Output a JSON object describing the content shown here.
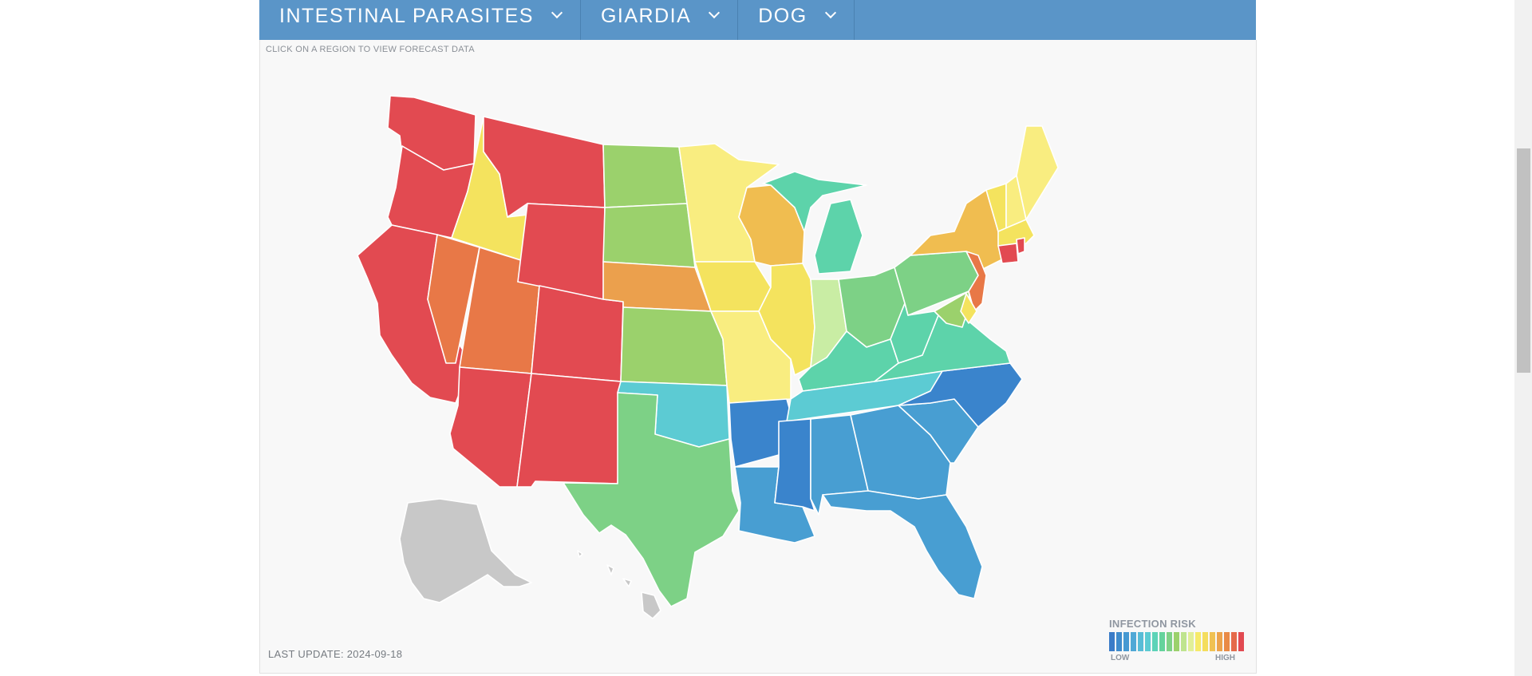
{
  "nav": {
    "items": [
      {
        "label": "INTESTINAL PARASITES"
      },
      {
        "label": "GIARDIA"
      },
      {
        "label": "DOG"
      }
    ]
  },
  "map": {
    "hint": "CLICK ON A REGION TO VIEW FORECAST DATA",
    "last_update": "LAST UPDATE: 2024-09-18",
    "colors": {
      "red": "#e24a51",
      "orange_red": "#e87847",
      "orange": "#eba04d",
      "orange_yellow": "#f0bd50",
      "yellow": "#f4e35e",
      "light_yellow": "#f9ed80",
      "pale_green": "#c9eda4",
      "green": "#9bd16c",
      "green2": "#7dd186",
      "teal": "#5dd3aa",
      "cyan": "#5ccbd3",
      "blue_light": "#489ed2",
      "blue": "#3a84cc",
      "gray": "#c8c8c8"
    },
    "regions": [
      {
        "name": "Washington",
        "level": "red"
      },
      {
        "name": "Oregon",
        "level": "red"
      },
      {
        "name": "California",
        "level": "red"
      },
      {
        "name": "Idaho",
        "level": "yellow"
      },
      {
        "name": "Nevada",
        "level": "orange_red"
      },
      {
        "name": "Utah",
        "level": "orange_red"
      },
      {
        "name": "Arizona",
        "level": "red"
      },
      {
        "name": "Montana",
        "level": "red"
      },
      {
        "name": "Wyoming",
        "level": "red"
      },
      {
        "name": "Colorado",
        "level": "red"
      },
      {
        "name": "New Mexico",
        "level": "red"
      },
      {
        "name": "North Dakota",
        "level": "green"
      },
      {
        "name": "South Dakota",
        "level": "green"
      },
      {
        "name": "Nebraska",
        "level": "orange"
      },
      {
        "name": "Kansas",
        "level": "green"
      },
      {
        "name": "Oklahoma",
        "level": "cyan"
      },
      {
        "name": "Texas",
        "level": "green2"
      },
      {
        "name": "Minnesota",
        "level": "light_yellow"
      },
      {
        "name": "Iowa",
        "level": "yellow"
      },
      {
        "name": "Missouri",
        "level": "light_yellow"
      },
      {
        "name": "Arkansas",
        "level": "blue"
      },
      {
        "name": "Louisiana",
        "level": "blue_light"
      },
      {
        "name": "Wisconsin",
        "level": "orange_yellow"
      },
      {
        "name": "Illinois",
        "level": "yellow"
      },
      {
        "name": "Michigan",
        "level": "teal"
      },
      {
        "name": "Indiana",
        "level": "pale_green"
      },
      {
        "name": "Ohio",
        "level": "green2"
      },
      {
        "name": "Kentucky",
        "level": "teal"
      },
      {
        "name": "Tennessee",
        "level": "cyan"
      },
      {
        "name": "Mississippi",
        "level": "blue"
      },
      {
        "name": "Alabama",
        "level": "blue_light"
      },
      {
        "name": "Georgia",
        "level": "blue_light"
      },
      {
        "name": "Florida",
        "level": "blue_light"
      },
      {
        "name": "South Carolina",
        "level": "blue_light"
      },
      {
        "name": "North Carolina",
        "level": "blue"
      },
      {
        "name": "Virginia",
        "level": "teal"
      },
      {
        "name": "West Virginia",
        "level": "teal"
      },
      {
        "name": "Pennsylvania",
        "level": "green2"
      },
      {
        "name": "New York",
        "level": "orange_yellow"
      },
      {
        "name": "New Jersey",
        "level": "orange_red"
      },
      {
        "name": "Maryland",
        "level": "green"
      },
      {
        "name": "Delaware",
        "level": "yellow"
      },
      {
        "name": "Vermont",
        "level": "yellow"
      },
      {
        "name": "New Hampshire",
        "level": "light_yellow"
      },
      {
        "name": "Maine",
        "level": "light_yellow"
      },
      {
        "name": "Massachusetts",
        "level": "yellow"
      },
      {
        "name": "Connecticut",
        "level": "red"
      },
      {
        "name": "Rhode Island",
        "level": "red"
      },
      {
        "name": "Alaska",
        "level": "gray"
      },
      {
        "name": "Hawaii",
        "level": "gray"
      }
    ]
  },
  "legend": {
    "title": "INFECTION RISK",
    "low_label": "LOW",
    "high_label": "HIGH",
    "scale": [
      "#3a7cc8",
      "#3f8ccd",
      "#4699d2",
      "#4fa8d6",
      "#58bcd6",
      "#5ccbd3",
      "#5dd3b8",
      "#65d39c",
      "#7fd187",
      "#9bd16c",
      "#bfe48f",
      "#e1ef98",
      "#f6ea6a",
      "#f4dd5e",
      "#f0c152",
      "#eca34c",
      "#e98a46",
      "#e56a4a",
      "#e24a51"
    ]
  }
}
